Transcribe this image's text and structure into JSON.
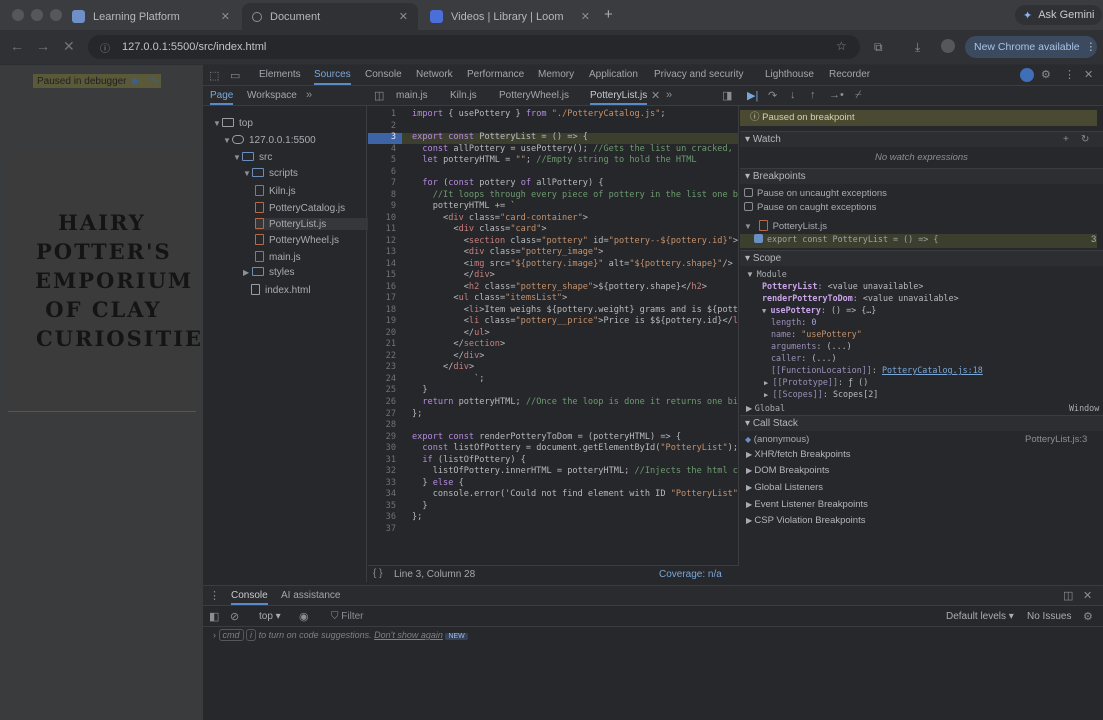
{
  "browser": {
    "tabs": [
      {
        "label": "Learning Platform",
        "icon": "learning-platform-favicon",
        "color": "#6f8fc7"
      },
      {
        "label": "Document",
        "icon": "document-favicon",
        "color": "#8a8d91"
      },
      {
        "label": "Videos | Library | Loom",
        "icon": "loom-favicon",
        "color": "#4a6fd8"
      }
    ],
    "ask_gemini": "Ask Gemini",
    "url": "127.0.0.1:5500/src/index.html",
    "new_chrome": "New Chrome available"
  },
  "page": {
    "paused_label": "Paused in debugger",
    "logo_lines": [
      "HAIRY",
      "POTTER'S",
      "EMPORIUM",
      " OF CLAY",
      "CURIOSITIE"
    ]
  },
  "devtools": {
    "panels": [
      "Elements",
      "Sources",
      "Console",
      "Network",
      "Performance",
      "Memory",
      "Application",
      "Privacy and security",
      "Lighthouse",
      "Recorder"
    ],
    "nav_tabs": [
      "Page",
      "Workspace"
    ],
    "file_tabs": [
      "main.js",
      "Kiln.js",
      "PotteryWheel.js",
      "PotteryList.js"
    ],
    "tree": [
      {
        "label": "top",
        "level": 0,
        "kind": "frame",
        "arrow": "▼"
      },
      {
        "label": "127.0.0.1:5500",
        "level": 1,
        "kind": "cloud",
        "arrow": "▼"
      },
      {
        "label": "src",
        "level": 2,
        "kind": "dir",
        "arrow": "▼"
      },
      {
        "label": "scripts",
        "level": 3,
        "kind": "dir",
        "arrow": "▼"
      },
      {
        "label": "Kiln.js",
        "level": 4,
        "kind": "file",
        "arrow": ""
      },
      {
        "label": "PotteryCatalog.js",
        "level": 4,
        "kind": "file",
        "arrow": ""
      },
      {
        "label": "PotteryList.js",
        "level": 4,
        "kind": "file",
        "arrow": ""
      },
      {
        "label": "PotteryWheel.js",
        "level": 4,
        "kind": "file",
        "arrow": ""
      },
      {
        "label": "main.js",
        "level": 4,
        "kind": "file",
        "arrow": ""
      },
      {
        "label": "styles",
        "level": 3,
        "kind": "dir",
        "arrow": "▶"
      },
      {
        "label": "index.html",
        "level": 3,
        "kind": "file",
        "arrow": ""
      }
    ],
    "code_lines": [
      "import { usePottery } from \"./PotteryCatalog.js\";",
      "",
      "export const PotteryList = () => {",
      "  const allPottery = usePottery(); //Gets the list un cracked, pri",
      "  let potteryHTML = \"\"; //Empty string to hold the HTML",
      "",
      "  for (const pottery of allPottery) {",
      "    //It loops through every piece of pottery in the list one by c",
      "    potteryHTML += `",
      "      <div class=\"card-container\">",
      "        <div class=\"card\">",
      "          <section class=\"pottery\" id=\"pottery--${pottery.id}\">",
      "          <div class=\"pottery_image\">",
      "          <img src=\"${pottery.image}\" alt=\"${pottery.shape}\"/>",
      "          </div>",
      "          <h2 class=\"pottery_shape\">${pottery.shape}</h2>",
      "        <ul class=\"itemsList\">",
      "          <li>Item weighs ${pottery.weight} grams and is ${potte",
      "          <li class=\"pottery__price\">Price is $${pottery.id}</li",
      "          </ul>",
      "        </section>",
      "        </div>",
      "      </div>",
      "            `;",
      "  }",
      "  return potteryHTML; //Once the loop is done it returns one big s",
      "};",
      "",
      "export const renderPotteryToDom = (potteryHTML) => {",
      "  const listOfPottery = document.getElementById(\"PotteryList\"); //",
      "  if (listOfPottery) {",
      "    listOfPottery.innerHTML = potteryHTML; //Injects the html card",
      "  } else {",
      "    console.error('Could not find element with ID \"PotteryList\");",
      "  }",
      "};",
      ""
    ],
    "status_position": "Line 3, Column 28",
    "coverage": "Coverage: n/a",
    "debugger": {
      "paused_on": "Paused on breakpoint",
      "watch": "Watch",
      "no_watch": "No watch expressions",
      "breakpoints": "Breakpoints",
      "pause_uncaught": "Pause on uncaught exceptions",
      "pause_caught": "Pause on caught exceptions",
      "bp_file": "PotteryList.js",
      "bp_code": "export const PotteryList = () => {",
      "bp_line": "3",
      "scope": "Scope",
      "module": "Module",
      "scope_rows": [
        {
          "name": "PotteryList",
          "value": "<value unavailable>"
        },
        {
          "name": "renderPotteryToDom",
          "value": "<value unavailable>"
        },
        {
          "name": "usePottery",
          "value": "() => {…}"
        },
        {
          "name": "length",
          "value": "0"
        },
        {
          "name": "name",
          "value": "\"usePottery\""
        },
        {
          "name": "arguments",
          "value": "(...)"
        },
        {
          "name": "caller",
          "value": "(...)"
        },
        {
          "name": "[[FunctionLocation]]",
          "value": "PotteryCatalog.js:18"
        },
        {
          "name": "[[Prototype]]",
          "value": "ƒ ()"
        },
        {
          "name": "[[Scopes]]",
          "value": "Scopes[2]"
        }
      ],
      "global": "Global",
      "global_value": "Window",
      "call_stack": "Call Stack",
      "frame": "(anonymous)",
      "frame_loc": "PotteryList.js:3",
      "more_sections": [
        "XHR/fetch Breakpoints",
        "DOM Breakpoints",
        "Global Listeners",
        "Event Listener Breakpoints",
        "CSP Violation Breakpoints"
      ]
    },
    "drawer": {
      "tabs": [
        "Console",
        "AI assistance"
      ],
      "context": "top",
      "filter": "Filter",
      "levels": "Default levels",
      "issues": "No Issues",
      "hint_cmd": "cmd",
      "hint_i": "i",
      "hint_text": "to turn on code suggestions.",
      "hint_link": "Don't show again",
      "hint_badge": "NEW"
    }
  }
}
